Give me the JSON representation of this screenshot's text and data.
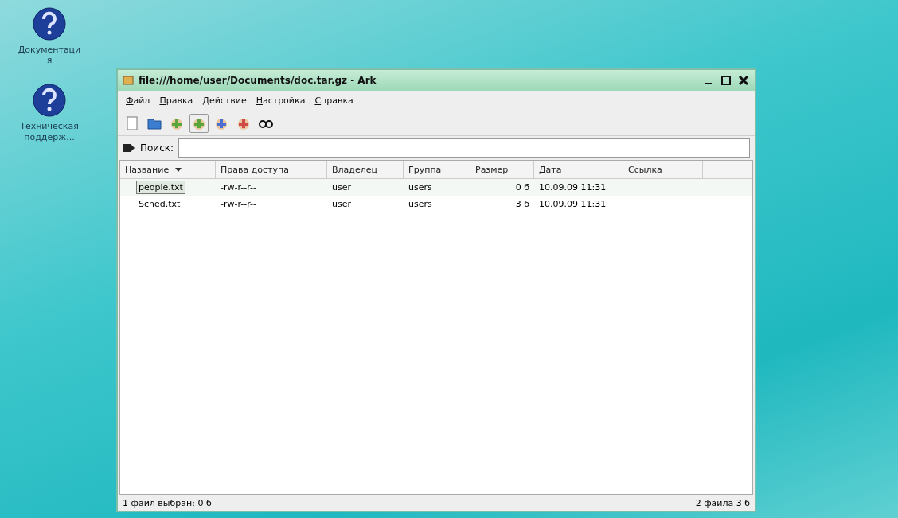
{
  "desktop_icons": [
    {
      "label": "Документация"
    },
    {
      "label": "Техническая поддерж..."
    }
  ],
  "window": {
    "title": "file:///home/user/Documents/doc.tar.gz - Ark"
  },
  "menu": [
    "Файл",
    "Правка",
    "Действие",
    "Настройка",
    "Справка"
  ],
  "search": {
    "label": "Поиск:"
  },
  "table": {
    "columns": [
      {
        "label": "Название",
        "sorted": true
      },
      {
        "label": "Права доступа",
        "sorted": false
      },
      {
        "label": "Владелец",
        "sorted": false
      },
      {
        "label": "Группа",
        "sorted": false
      },
      {
        "label": "Размер",
        "sorted": false
      },
      {
        "label": "Дата",
        "sorted": false
      },
      {
        "label": "Ссылка",
        "sorted": false
      }
    ],
    "rows": [
      {
        "selected": true,
        "cells": [
          "people.txt",
          "-rw-r--r--",
          "user",
          "users",
          "0 б",
          "10.09.09 11:31"
        ]
      },
      {
        "selected": false,
        "cells": [
          "Sched.txt",
          "-rw-r--r--",
          "user",
          "users",
          "3 б",
          "10.09.09 11:31"
        ]
      }
    ]
  },
  "status_bar": {
    "left": "1 файл выбран: 0 б",
    "right": "2 файла 3 б"
  }
}
